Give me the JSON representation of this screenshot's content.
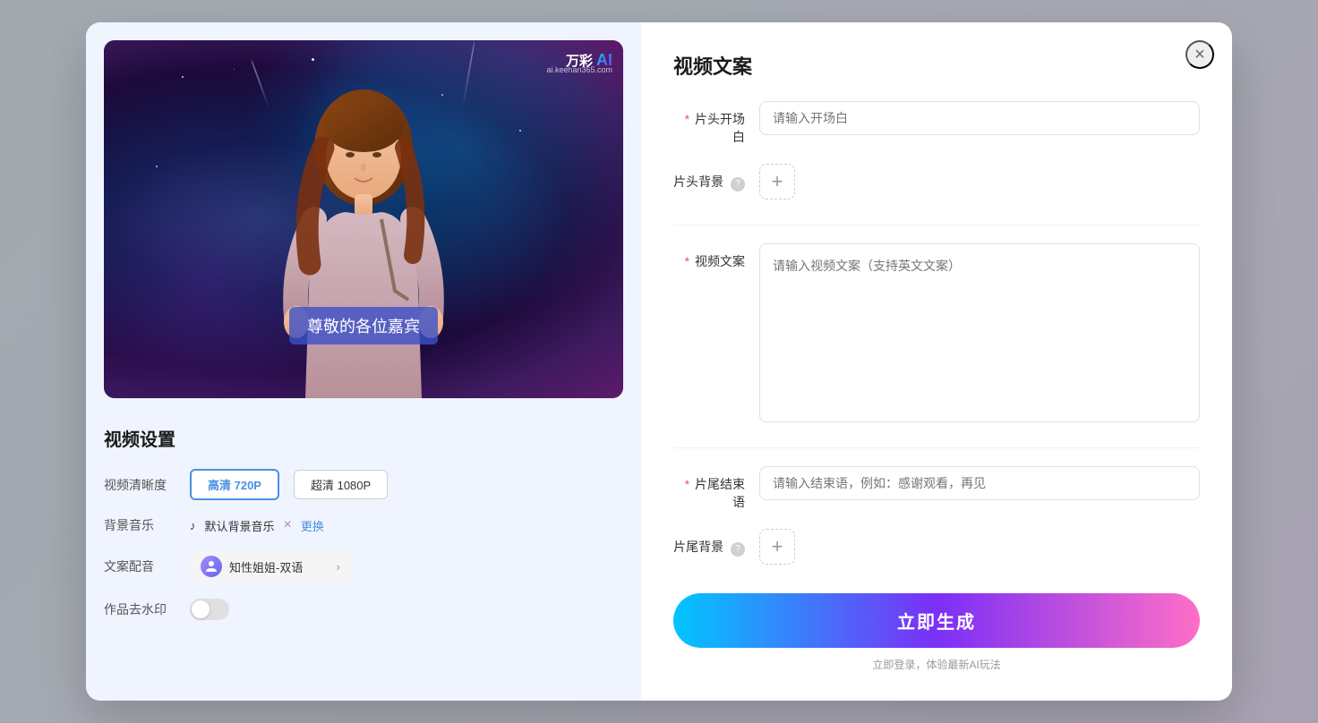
{
  "modal": {
    "left": {
      "watermark_brand": "万彩",
      "watermark_ai": "AI",
      "watermark_sub": "ai.keehan365.com",
      "subtitle": "尊敬的各位嘉宾",
      "settings_title": "视频设置",
      "quality_label": "视频清晰度",
      "quality_options": [
        {
          "label": "高清 720P",
          "active": true
        },
        {
          "label": "超清 1080P",
          "active": false
        }
      ],
      "music_label": "背景音乐",
      "music_name": "默认背景音乐",
      "music_replace": "更换",
      "voice_label": "文案配音",
      "voice_name": "知性姐姐-双语",
      "watermark_label": "作品去水印",
      "toggle_on": false
    },
    "right": {
      "title": "视频文案",
      "close_label": "×",
      "fields": [
        {
          "key": "intro",
          "label": "片头开场白",
          "required": true,
          "type": "input",
          "placeholder": "请输入开场白"
        },
        {
          "key": "intro_bg",
          "label": "片头背景",
          "required": false,
          "type": "add",
          "has_help": true
        },
        {
          "key": "content",
          "label": "视频文案",
          "required": true,
          "type": "textarea",
          "placeholder": "请输入视频文案（支持英文文案）"
        },
        {
          "key": "outro",
          "label": "片尾结束语",
          "required": true,
          "type": "input",
          "placeholder": "请输入结束语，例如：感谢观看，再见"
        },
        {
          "key": "outro_bg",
          "label": "片尾背景",
          "required": false,
          "type": "add",
          "has_help": true
        }
      ],
      "generate_btn": "立即生成",
      "generate_hint": "立即登录，体验最新AI玩法"
    }
  }
}
